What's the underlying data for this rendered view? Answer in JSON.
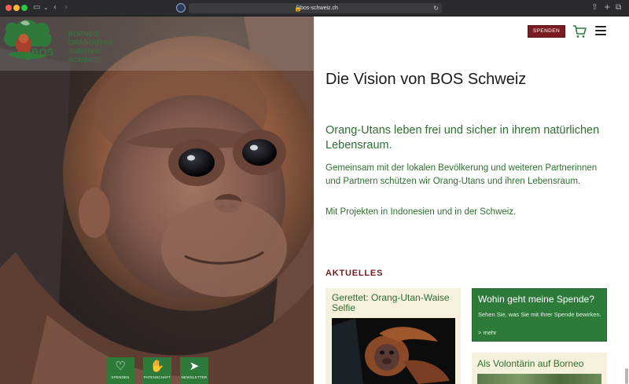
{
  "browser": {
    "url": "bos-schweiz.ch",
    "icons": [
      "sidebar-icon",
      "back-icon",
      "forward-icon",
      "privacy-shield-icon",
      "lock-icon",
      "reload-icon",
      "share-icon",
      "new-tab-icon",
      "tabs-overview-icon"
    ]
  },
  "logo": {
    "mark_text": "BOS",
    "lines": [
      "BORNEO",
      "ORANGUTAN",
      "SURVIVAL",
      "SCHWEIZ"
    ]
  },
  "header": {
    "donate_label": "SPENDEN"
  },
  "hero": {
    "quick_actions": [
      {
        "label": "SPENDEN",
        "icon": "heart-hand-icon"
      },
      {
        "label": "PATENSCHAFT",
        "icon": "handshake-icon"
      },
      {
        "label": "NEWSLETTER",
        "icon": "paper-plane-icon"
      }
    ]
  },
  "main": {
    "title": "Die Vision von BOS Schweiz",
    "lead": "Orang-Utans leben frei und sicher in ihrem natürlichen Lebensraum.",
    "body1": "Gemeinsam mit der lokalen Bevölkerung und weiteren Partnerinnen und Partnern schützen wir Orang-Utans und ihren Lebensraum.",
    "body2": "Mit Projekten in Indonesien und in der Schweiz."
  },
  "news": {
    "heading": "AKTUELLES",
    "card1": {
      "title": "Gerettet: Orang-Utan-Waise Selfie"
    },
    "card2": {
      "title": "Wohin geht meine Spende?",
      "text": "Sehen Sie, was Sie mit Ihrer Spende bewirken.",
      "more": "> mehr"
    },
    "card3": {
      "title": "Als Volontärin auf Borneo"
    }
  },
  "colors": {
    "brand_green": "#2d7a3a",
    "text_green": "#2d6e32",
    "donate_red": "#7a1d22",
    "card_beige": "#f5f1dc"
  }
}
